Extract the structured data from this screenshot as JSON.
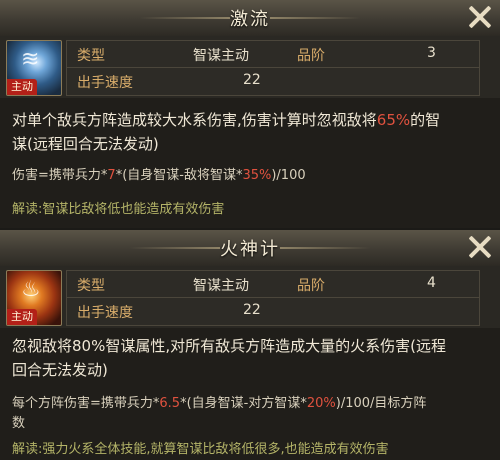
{
  "skills": [
    {
      "title": "激流",
      "icon_tag": "主动",
      "icon_name": "water-skill-icon",
      "type_label": "类型",
      "type_value": "智谋主动",
      "rank_label": "品阶",
      "rank_value": "3",
      "speed_label": "出手速度",
      "speed_value": "22",
      "desc_line1_a": "对单个敌兵方阵造成较大水系伤害,伤害计算时忽视敌将",
      "desc_line1_hl": "65%",
      "desc_line1_b": "的智",
      "desc_line2": "谋(远程回合无法发动)",
      "formula_a": "伤害=携带兵力*",
      "formula_hl1": "7",
      "formula_b": "*(自身智谋-敌将智谋*",
      "formula_hl2": "35%",
      "formula_c": ")/100",
      "note": "解读:智谋比敌将低也能造成有效伤害"
    },
    {
      "title": "火神计",
      "icon_tag": "主动",
      "icon_name": "fire-skill-icon",
      "type_label": "类型",
      "type_value": "智谋主动",
      "rank_label": "品阶",
      "rank_value": "4",
      "speed_label": "出手速度",
      "speed_value": "22",
      "desc_line1": "忽视敌将80%智谋属性,对所有敌兵方阵造成大量的火系伤害(远程",
      "desc_line2": "回合无法发动)",
      "formula_a": "每个方阵伤害=携带兵力*",
      "formula_hl1": "6.5",
      "formula_b": "*(自身智谋-对方智谋*",
      "formula_hl2": "20%",
      "formula_c": ")/100/目标方阵",
      "formula_line2": "数",
      "note": "解读:强力火系全体技能,就算智谋比敌将低很多,也能造成有效伤害"
    }
  ],
  "colors": {
    "label_gold": "#d8ac6a",
    "highlight_red": "#e0523f",
    "note_olive": "#b4b468",
    "tag_red": "#b32018"
  }
}
